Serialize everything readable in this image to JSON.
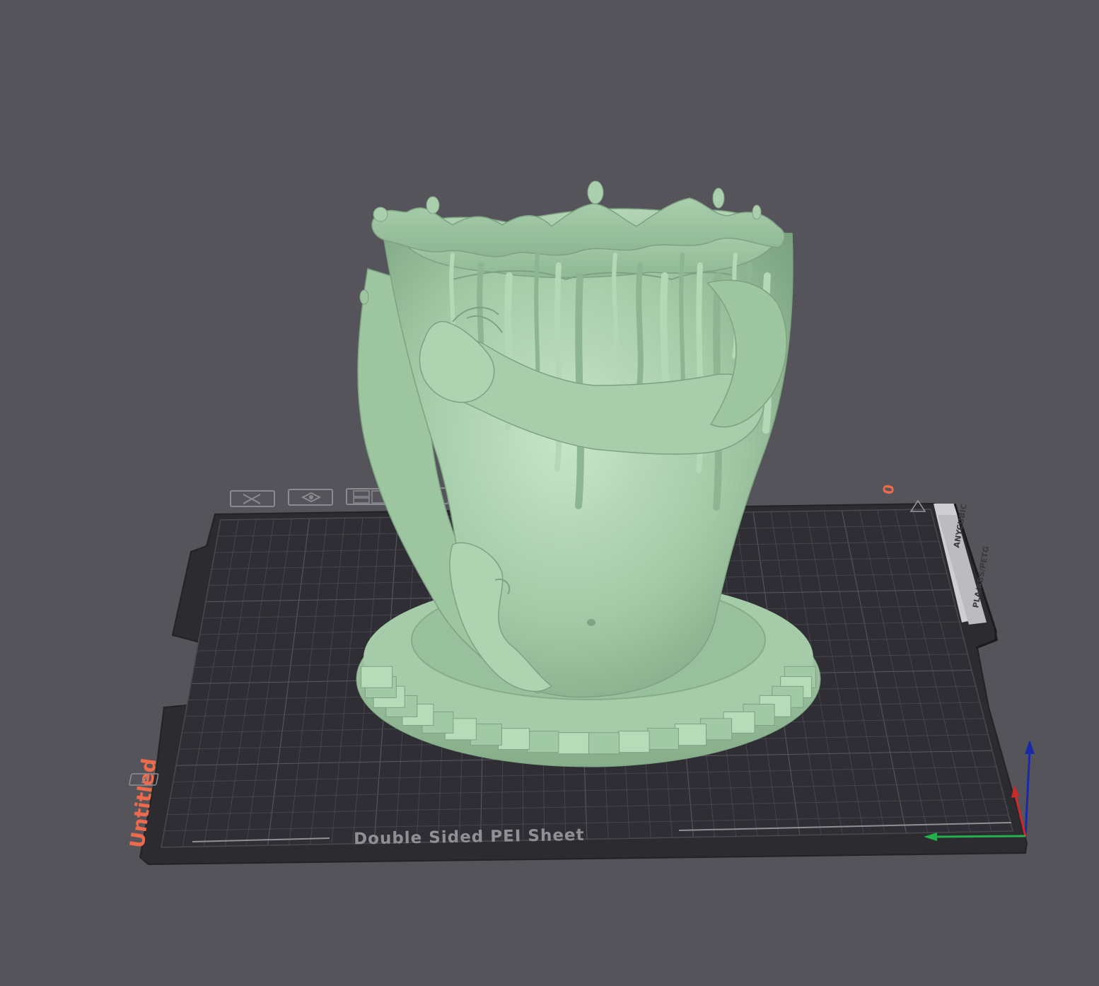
{
  "viewport": {
    "background": "#55545a",
    "model_color": "#9dc6a2",
    "plate_color": "#2c2b30",
    "accent_color": "#ef6a4a"
  },
  "plate": {
    "name": "Untitled",
    "sheet_label": "Double Sided PEI Sheet",
    "brand_label": "ANYCUBIC",
    "material_label": "PLA/ABS/PETG",
    "index_label": "0"
  },
  "plate_toolbar": {
    "icons": [
      "close-icon",
      "arrange-icon",
      "layout-icon",
      "settings-icon"
    ]
  },
  "axes": {
    "x_color": "#cc2a2a",
    "y_color": "#22b14c",
    "z_color": "#1b2aa6"
  },
  "model": {
    "name": "splash vase with hands"
  }
}
